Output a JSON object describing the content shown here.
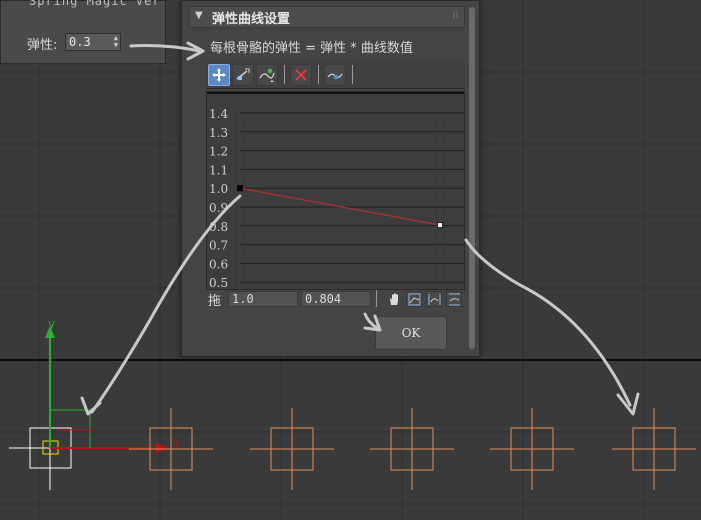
{
  "param_panel": {
    "cut_title": "Spring Magic Ver",
    "label": "弹性:",
    "value": "0.3"
  },
  "dialog": {
    "title": "弹性曲线设置",
    "formula": "每根骨骼的弹性 = 弹性 * 曲线数值",
    "graph": {
      "y_ticks": [
        "1.4",
        "1.3",
        "1.2",
        "1.1",
        "1.0",
        "0.9",
        "0.8",
        "0.7",
        "0.6",
        "0.5"
      ],
      "points": [
        {
          "x": 0.0,
          "y": 1.0
        },
        {
          "x": 1.0,
          "y": 0.804
        }
      ],
      "curve_color": "#b03030"
    },
    "status": {
      "label": "拖",
      "x_value": "1.0",
      "y_value": "0.804"
    },
    "ok_label": "OK"
  },
  "viewport": {
    "axis_y_label": "y",
    "axis_x_label": "x",
    "bone_color": "#e0905a",
    "axis_y_color": "#2ab02a",
    "axis_x_color": "#c01010"
  }
}
